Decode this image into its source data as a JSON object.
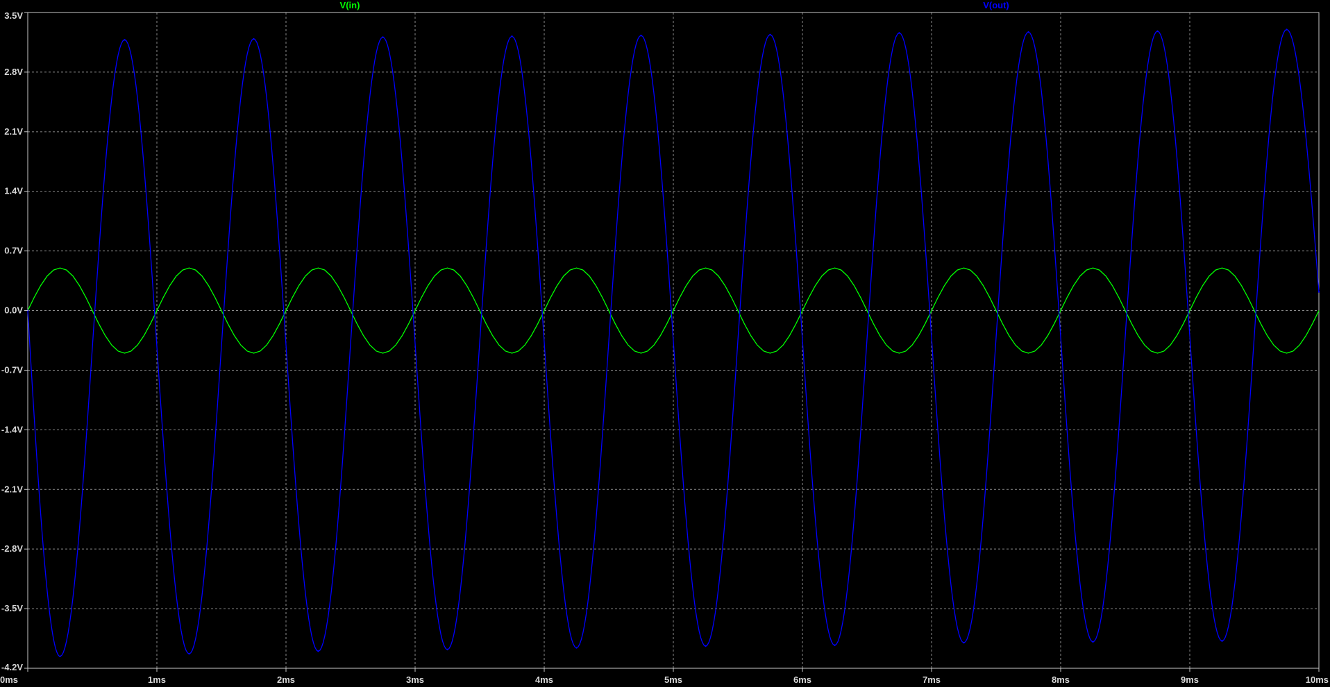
{
  "chart_data": {
    "type": "line",
    "xlim": [
      0,
      10
    ],
    "ylim": [
      -4.2,
      3.5
    ],
    "grid": true,
    "legend": "top",
    "background": "#000000",
    "grid_color": "#8a8a8a",
    "axis_color": "#c8c8c8",
    "x_ticks": [
      {
        "value": 0,
        "label": "0ms"
      },
      {
        "value": 1,
        "label": "1ms"
      },
      {
        "value": 2,
        "label": "2ms"
      },
      {
        "value": 3,
        "label": "3ms"
      },
      {
        "value": 4,
        "label": "4ms"
      },
      {
        "value": 5,
        "label": "5ms"
      },
      {
        "value": 6,
        "label": "6ms"
      },
      {
        "value": 7,
        "label": "7ms"
      },
      {
        "value": 8,
        "label": "8ms"
      },
      {
        "value": 9,
        "label": "9ms"
      },
      {
        "value": 10,
        "label": "10ms"
      }
    ],
    "y_ticks": [
      {
        "value": 3.5,
        "label": "3.5V"
      },
      {
        "value": 2.8,
        "label": "2.8V"
      },
      {
        "value": 2.1,
        "label": "2.1V"
      },
      {
        "value": 1.4,
        "label": "1.4V"
      },
      {
        "value": 0.7,
        "label": "0.7V"
      },
      {
        "value": 0.0,
        "label": "0.0V"
      },
      {
        "value": -0.7,
        "label": "-0.7V"
      },
      {
        "value": -1.4,
        "label": "-1.4V"
      },
      {
        "value": -2.1,
        "label": "-2.1V"
      },
      {
        "value": -2.8,
        "label": "-2.8V"
      },
      {
        "value": -3.5,
        "label": "-3.5V"
      },
      {
        "value": -4.2,
        "label": "-4.2V"
      }
    ],
    "series": [
      {
        "name": "V(in)",
        "color": "#00ff00",
        "frequency_khz": 1,
        "x": [
          0,
          0.05,
          0.1,
          0.15,
          0.2,
          0.25,
          0.3,
          0.35,
          0.4,
          0.45,
          0.5,
          0.55,
          0.6,
          0.65,
          0.7,
          0.75,
          0.8,
          0.85,
          0.9,
          0.95,
          1.0,
          1.05,
          1.1,
          1.15,
          1.2,
          1.25,
          1.3,
          1.35,
          1.4,
          1.45,
          1.5,
          1.55,
          1.6,
          1.65,
          1.7,
          1.75,
          1.8,
          1.85,
          1.9,
          1.95,
          2.0,
          2.05,
          2.1,
          2.15,
          2.2,
          2.25,
          2.3,
          2.35,
          2.4,
          2.45,
          2.5,
          2.55,
          2.6,
          2.65,
          2.7,
          2.75,
          2.8,
          2.85,
          2.9,
          2.95,
          3.0,
          3.05,
          3.1,
          3.15,
          3.2,
          3.25,
          3.3,
          3.35,
          3.4,
          3.45,
          3.5,
          3.55,
          3.6,
          3.65,
          3.7,
          3.75,
          3.8,
          3.85,
          3.9,
          3.95,
          4.0,
          4.05,
          4.1,
          4.15,
          4.2,
          4.25,
          4.3,
          4.35,
          4.4,
          4.45,
          4.5,
          4.55,
          4.6,
          4.65,
          4.7,
          4.75,
          4.8,
          4.85,
          4.9,
          4.95,
          5.0,
          5.05,
          5.1,
          5.15,
          5.2,
          5.25,
          5.3,
          5.35,
          5.4,
          5.45,
          5.5,
          5.55,
          5.6,
          5.65,
          5.7,
          5.75,
          5.8,
          5.85,
          5.9,
          5.95,
          6.0,
          6.05,
          6.1,
          6.15,
          6.2,
          6.25,
          6.3,
          6.35,
          6.4,
          6.45,
          6.5,
          6.55,
          6.6,
          6.65,
          6.7,
          6.75,
          6.8,
          6.85,
          6.9,
          6.95,
          7.0,
          7.05,
          7.1,
          7.15,
          7.2,
          7.25,
          7.3,
          7.35,
          7.4,
          7.45,
          7.5,
          7.55,
          7.6,
          7.65,
          7.7,
          7.75,
          7.8,
          7.85,
          7.9,
          7.95,
          8.0,
          8.05,
          8.1,
          8.15,
          8.2,
          8.25,
          8.3,
          8.35,
          8.4,
          8.45,
          8.5,
          8.55,
          8.6,
          8.65,
          8.7,
          8.75,
          8.8,
          8.85,
          8.9,
          8.95,
          9.0,
          9.05,
          9.1,
          9.15,
          9.2,
          9.25,
          9.3,
          9.35,
          9.4,
          9.45,
          9.5,
          9.55,
          9.6,
          9.65,
          9.7,
          9.75,
          9.8,
          9.85,
          9.9,
          9.95,
          10.0
        ],
        "values": [
          0,
          0.155,
          0.294,
          0.405,
          0.476,
          0.5,
          0.476,
          0.405,
          0.294,
          0.155,
          0,
          -0.155,
          -0.294,
          -0.405,
          -0.476,
          -0.5,
          -0.476,
          -0.405,
          -0.294,
          -0.155,
          0,
          0.155,
          0.294,
          0.405,
          0.476,
          0.5,
          0.476,
          0.405,
          0.294,
          0.155,
          0,
          -0.155,
          -0.294,
          -0.405,
          -0.476,
          -0.5,
          -0.476,
          -0.405,
          -0.294,
          -0.155,
          0,
          0.155,
          0.294,
          0.405,
          0.476,
          0.5,
          0.476,
          0.405,
          0.294,
          0.155,
          0,
          -0.155,
          -0.294,
          -0.405,
          -0.476,
          -0.5,
          -0.476,
          -0.405,
          -0.294,
          -0.155,
          0,
          0.155,
          0.294,
          0.405,
          0.476,
          0.5,
          0.476,
          0.405,
          0.294,
          0.155,
          0,
          -0.155,
          -0.294,
          -0.405,
          -0.476,
          -0.5,
          -0.476,
          -0.405,
          -0.294,
          -0.155,
          0,
          0.155,
          0.294,
          0.405,
          0.476,
          0.5,
          0.476,
          0.405,
          0.294,
          0.155,
          0,
          -0.155,
          -0.294,
          -0.405,
          -0.476,
          -0.5,
          -0.476,
          -0.405,
          -0.294,
          -0.155,
          0,
          0.155,
          0.294,
          0.405,
          0.476,
          0.5,
          0.476,
          0.405,
          0.294,
          0.155,
          0,
          -0.155,
          -0.294,
          -0.405,
          -0.476,
          -0.5,
          -0.476,
          -0.405,
          -0.294,
          -0.155,
          0,
          0.155,
          0.294,
          0.405,
          0.476,
          0.5,
          0.476,
          0.405,
          0.294,
          0.155,
          0,
          -0.155,
          -0.294,
          -0.405,
          -0.476,
          -0.5,
          -0.476,
          -0.405,
          -0.294,
          -0.155,
          0,
          0.155,
          0.294,
          0.405,
          0.476,
          0.5,
          0.476,
          0.405,
          0.294,
          0.155,
          0,
          -0.155,
          -0.294,
          -0.405,
          -0.476,
          -0.5,
          -0.476,
          -0.405,
          -0.294,
          -0.155,
          0,
          0.155,
          0.294,
          0.405,
          0.476,
          0.5,
          0.476,
          0.405,
          0.294,
          0.155,
          0,
          -0.155,
          -0.294,
          -0.405,
          -0.476,
          -0.5,
          -0.476,
          -0.405,
          -0.294,
          -0.155,
          0,
          0.155,
          0.294,
          0.405,
          0.476,
          0.5,
          0.476,
          0.405,
          0.294,
          0.155,
          0,
          -0.155,
          -0.294,
          -0.405,
          -0.476,
          -0.5,
          -0.476,
          -0.405,
          -0.294,
          -0.155,
          0
        ]
      },
      {
        "name": "V(out)",
        "color": "#0000ff",
        "frequency_khz": 1,
        "x": [
          0,
          0.25,
          0.75,
          1.25,
          1.75,
          2.25,
          2.75,
          3.25,
          3.75,
          4.25,
          4.75,
          5.25,
          5.75,
          6.25,
          6.75,
          7.25,
          7.75,
          8.25,
          8.75,
          9.25,
          9.75,
          10.0
        ],
        "values": [
          0,
          -4.06,
          3.18,
          -4.03,
          3.19,
          -4.0,
          3.21,
          -3.98,
          3.22,
          -3.96,
          3.23,
          -3.94,
          3.24,
          -3.93,
          3.26,
          -3.9,
          3.27,
          -3.89,
          3.28,
          -3.88,
          3.3,
          0.22
        ]
      }
    ]
  }
}
